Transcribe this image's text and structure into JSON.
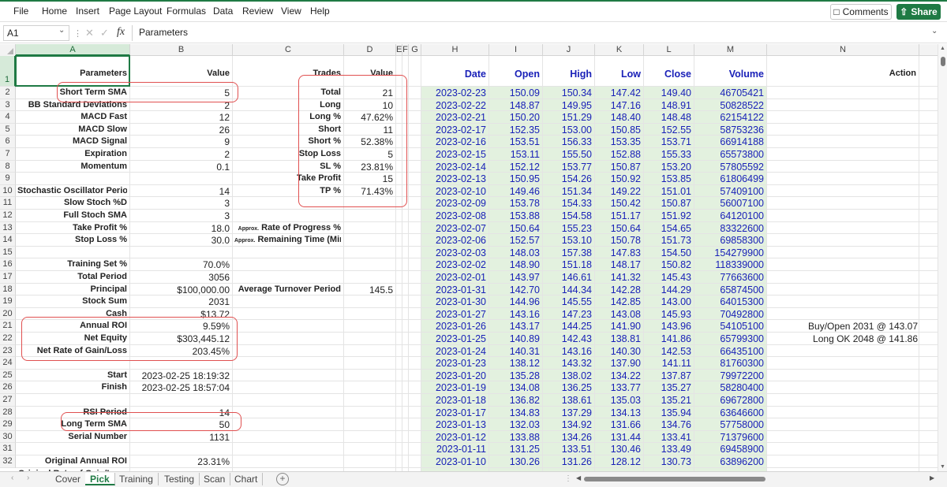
{
  "menu": [
    "File",
    "Home",
    "Insert",
    "Page Layout",
    "Formulas",
    "Data",
    "Review",
    "View",
    "Help"
  ],
  "buttons": {
    "comments": "Comments",
    "share": "Share"
  },
  "formula_bar": {
    "name_box": "A1",
    "fx": "fx",
    "formula": "Parameters"
  },
  "columns": [
    "A",
    "B",
    "C",
    "D",
    "E",
    "F",
    "G",
    "H",
    "I",
    "J",
    "K",
    "L",
    "M",
    "N"
  ],
  "rows": [
    "1",
    "2",
    "3",
    "4",
    "5",
    "6",
    "7",
    "8",
    "9",
    "10",
    "11",
    "12",
    "13",
    "14",
    "15",
    "16",
    "17",
    "18",
    "19",
    "20",
    "21",
    "22",
    "23",
    "24",
    "25",
    "26",
    "27",
    "28",
    "29",
    "30",
    "31",
    "32"
  ],
  "headers": {
    "parameters": "Parameters",
    "value": "Value",
    "trades": "Trades",
    "trades_value": "Value",
    "date": "Date",
    "open": "Open",
    "high": "High",
    "low": "Low",
    "close": "Close",
    "volume": "Volume",
    "action": "Action"
  },
  "params": [
    {
      "row": 2,
      "name": "Short Term SMA",
      "value": "5"
    },
    {
      "row": 3,
      "name": "BB Standard Deviations",
      "value": "2"
    },
    {
      "row": 4,
      "name": "MACD Fast",
      "value": "12"
    },
    {
      "row": 5,
      "name": "MACD Slow",
      "value": "26"
    },
    {
      "row": 6,
      "name": "MACD Signal",
      "value": "9"
    },
    {
      "row": 7,
      "name": "Expiration",
      "value": "2"
    },
    {
      "row": 8,
      "name": "Momentum",
      "value": "0.1"
    },
    {
      "row": 10,
      "name": "Stochastic Oscillator Period",
      "value": "14"
    },
    {
      "row": 11,
      "name": "Slow Stoch %D",
      "value": "3"
    },
    {
      "row": 12,
      "name": "Full Stoch SMA",
      "value": "3"
    },
    {
      "row": 13,
      "name": "Take Profit %",
      "value": "18.0"
    },
    {
      "row": 14,
      "name": "Stop Loss %",
      "value": "30.0"
    },
    {
      "row": 16,
      "name": "Training Set %",
      "value": "70.0%"
    },
    {
      "row": 17,
      "name": "Total Period",
      "value": "3056"
    },
    {
      "row": 18,
      "name": "Principal",
      "value": "$100,000.00"
    },
    {
      "row": 19,
      "name": "Stock Sum",
      "value": "2031"
    },
    {
      "row": 20,
      "name": "Cash",
      "value": "$13.72"
    },
    {
      "row": 21,
      "name": "Annual ROI",
      "value": "9.59%"
    },
    {
      "row": 22,
      "name": "Net Equity",
      "value": "$303,445.12"
    },
    {
      "row": 23,
      "name": "Net Rate of Gain/Loss",
      "value": "203.45%"
    },
    {
      "row": 25,
      "name": "Start",
      "value": "2023-02-25 18:19:32"
    },
    {
      "row": 26,
      "name": "Finish",
      "value": "2023-02-25 18:57:04"
    },
    {
      "row": 28,
      "name": "RSI Period",
      "value": "14"
    },
    {
      "row": 29,
      "name": "Long Term SMA",
      "value": "50"
    },
    {
      "row": 30,
      "name": "Serial Number",
      "value": "1131"
    },
    {
      "row": 32,
      "name": "Original Annual ROI",
      "value": "23.31%"
    }
  ],
  "trades": [
    {
      "row": 2,
      "name": "Total",
      "value": "21"
    },
    {
      "row": 3,
      "name": "Long",
      "value": "10"
    },
    {
      "row": 4,
      "name": "Long %",
      "value": "47.62%"
    },
    {
      "row": 5,
      "name": "Short",
      "value": "11"
    },
    {
      "row": 6,
      "name": "Short %",
      "value": "52.38%"
    },
    {
      "row": 7,
      "name": "Stop Loss",
      "value": "5"
    },
    {
      "row": 8,
      "name": "SL %",
      "value": "23.81%"
    },
    {
      "row": 9,
      "name": "Take Profit",
      "value": "15"
    },
    {
      "row": 10,
      "name": "TP %",
      "value": "71.43%"
    }
  ],
  "approx": [
    {
      "row": 13,
      "prefix": "Approx.",
      "label": "Rate of Progress %"
    },
    {
      "row": 14,
      "prefix": "Approx.",
      "label": "Remaining Time (Min.)"
    }
  ],
  "turnover": {
    "row": 18,
    "label": "Average Turnover Period",
    "value": "145.5"
  },
  "prices": [
    {
      "date": "2023-02-23",
      "open": "150.09",
      "high": "150.34",
      "low": "147.42",
      "close": "149.40",
      "volume": "46705421"
    },
    {
      "date": "2023-02-22",
      "open": "148.87",
      "high": "149.95",
      "low": "147.16",
      "close": "148.91",
      "volume": "50828522"
    },
    {
      "date": "2023-02-21",
      "open": "150.20",
      "high": "151.29",
      "low": "148.40",
      "close": "148.48",
      "volume": "62154122"
    },
    {
      "date": "2023-02-17",
      "open": "152.35",
      "high": "153.00",
      "low": "150.85",
      "close": "152.55",
      "volume": "58753236"
    },
    {
      "date": "2023-02-16",
      "open": "153.51",
      "high": "156.33",
      "low": "153.35",
      "close": "153.71",
      "volume": "66914188"
    },
    {
      "date": "2023-02-15",
      "open": "153.11",
      "high": "155.50",
      "low": "152.88",
      "close": "155.33",
      "volume": "65573800"
    },
    {
      "date": "2023-02-14",
      "open": "152.12",
      "high": "153.77",
      "low": "150.87",
      "close": "153.20",
      "volume": "57805592"
    },
    {
      "date": "2023-02-13",
      "open": "150.95",
      "high": "154.26",
      "low": "150.92",
      "close": "153.85",
      "volume": "61806499"
    },
    {
      "date": "2023-02-10",
      "open": "149.46",
      "high": "151.34",
      "low": "149.22",
      "close": "151.01",
      "volume": "57409100"
    },
    {
      "date": "2023-02-09",
      "open": "153.78",
      "high": "154.33",
      "low": "150.42",
      "close": "150.87",
      "volume": "56007100"
    },
    {
      "date": "2023-02-08",
      "open": "153.88",
      "high": "154.58",
      "low": "151.17",
      "close": "151.92",
      "volume": "64120100"
    },
    {
      "date": "2023-02-07",
      "open": "150.64",
      "high": "155.23",
      "low": "150.64",
      "close": "154.65",
      "volume": "83322600"
    },
    {
      "date": "2023-02-06",
      "open": "152.57",
      "high": "153.10",
      "low": "150.78",
      "close": "151.73",
      "volume": "69858300"
    },
    {
      "date": "2023-02-03",
      "open": "148.03",
      "high": "157.38",
      "low": "147.83",
      "close": "154.50",
      "volume": "154279900"
    },
    {
      "date": "2023-02-02",
      "open": "148.90",
      "high": "151.18",
      "low": "148.17",
      "close": "150.82",
      "volume": "118339000"
    },
    {
      "date": "2023-02-01",
      "open": "143.97",
      "high": "146.61",
      "low": "141.32",
      "close": "145.43",
      "volume": "77663600"
    },
    {
      "date": "2023-01-31",
      "open": "142.70",
      "high": "144.34",
      "low": "142.28",
      "close": "144.29",
      "volume": "65874500"
    },
    {
      "date": "2023-01-30",
      "open": "144.96",
      "high": "145.55",
      "low": "142.85",
      "close": "143.00",
      "volume": "64015300"
    },
    {
      "date": "2023-01-27",
      "open": "143.16",
      "high": "147.23",
      "low": "143.08",
      "close": "145.93",
      "volume": "70492800"
    },
    {
      "date": "2023-01-26",
      "open": "143.17",
      "high": "144.25",
      "low": "141.90",
      "close": "143.96",
      "volume": "54105100"
    },
    {
      "date": "2023-01-25",
      "open": "140.89",
      "high": "142.43",
      "low": "138.81",
      "close": "141.86",
      "volume": "65799300"
    },
    {
      "date": "2023-01-24",
      "open": "140.31",
      "high": "143.16",
      "low": "140.30",
      "close": "142.53",
      "volume": "66435100"
    },
    {
      "date": "2023-01-23",
      "open": "138.12",
      "high": "143.32",
      "low": "137.90",
      "close": "141.11",
      "volume": "81760300"
    },
    {
      "date": "2023-01-20",
      "open": "135.28",
      "high": "138.02",
      "low": "134.22",
      "close": "137.87",
      "volume": "79972200"
    },
    {
      "date": "2023-01-19",
      "open": "134.08",
      "high": "136.25",
      "low": "133.77",
      "close": "135.27",
      "volume": "58280400"
    },
    {
      "date": "2023-01-18",
      "open": "136.82",
      "high": "138.61",
      "low": "135.03",
      "close": "135.21",
      "volume": "69672800"
    },
    {
      "date": "2023-01-17",
      "open": "134.83",
      "high": "137.29",
      "low": "134.13",
      "close": "135.94",
      "volume": "63646600"
    },
    {
      "date": "2023-01-13",
      "open": "132.03",
      "high": "134.92",
      "low": "131.66",
      "close": "134.76",
      "volume": "57758000"
    },
    {
      "date": "2023-01-12",
      "open": "133.88",
      "high": "134.26",
      "low": "131.44",
      "close": "133.41",
      "volume": "71379600"
    },
    {
      "date": "2023-01-11",
      "open": "131.25",
      "high": "133.51",
      "low": "130.46",
      "close": "133.49",
      "volume": "69458900"
    },
    {
      "date": "2023-01-10",
      "open": "130.26",
      "high": "131.26",
      "low": "128.12",
      "close": "130.73",
      "volume": "63896200"
    }
  ],
  "actions": [
    {
      "row": 21,
      "text": "Buy/Open 2031 @ 143.07"
    },
    {
      "row": 22,
      "text": "Long OK 2048 @ 141.86"
    }
  ],
  "partial_row": {
    "label": "Original Rate of Gain/Loss"
  },
  "sheet_tabs": [
    "Cover",
    "Pick",
    "Training",
    "Testing",
    "Scan",
    "Chart"
  ],
  "active_tab": "Pick",
  "colors": {
    "accent": "#1f7a44",
    "price_bg": "#e3f1df",
    "price_text": "#1a21b8",
    "highlight": "#e05050"
  }
}
